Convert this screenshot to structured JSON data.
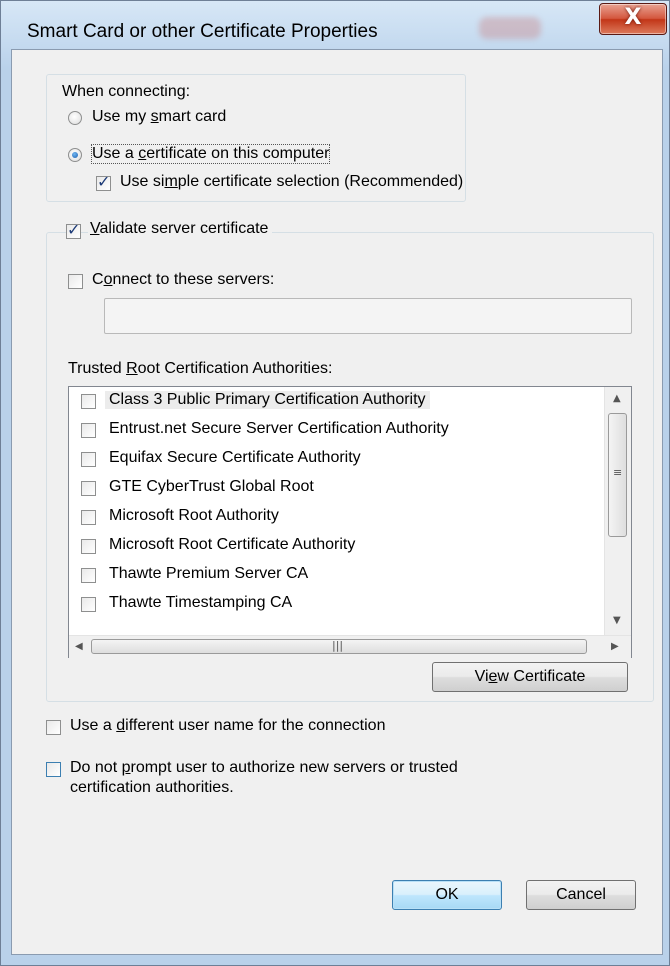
{
  "window": {
    "title": "Smart Card or other Certificate Properties",
    "close_glyph": "X"
  },
  "when_connecting": {
    "label": "When connecting:",
    "use_smart_card": "Use my smart card",
    "use_certificate": "Use a certificate on this computer",
    "simple_selection": "Use simple certificate selection (Recommended)"
  },
  "validate": {
    "label": "Validate server certificate",
    "connect_servers": "Connect to these servers:",
    "servers_value": "",
    "trusted_label": "Trusted Root Certification Authorities:",
    "authorities": [
      "Class 3 Public Primary Certification Authority",
      "Entrust.net Secure Server Certification Authority",
      "Equifax Secure Certificate Authority",
      "GTE CyberTrust Global Root",
      "Microsoft Root Authority",
      "Microsoft Root Certificate Authority",
      "Thawte Premium Server CA",
      "Thawte Timestamping CA"
    ],
    "view_certificate": "View Certificate"
  },
  "options": {
    "different_user": "Use a different user name for the connection",
    "no_prompt_line1": "Do not prompt user to authorize new servers or trusted",
    "no_prompt_line2": "certification authorities."
  },
  "buttons": {
    "ok": "OK",
    "cancel": "Cancel"
  },
  "icons": {
    "close": "close-icon",
    "radio": "radio-icon",
    "checkbox": "checkbox-icon"
  }
}
